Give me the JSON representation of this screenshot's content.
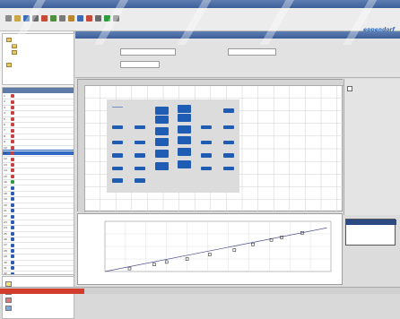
{
  "app": {
    "title": "",
    "logo_text": "eppendorf"
  },
  "colors": {
    "accent": "#3c5d97",
    "band": "#1f5cb4",
    "status": "#d23c2c"
  },
  "toolbar": {
    "icons": [
      "new-icon",
      "open-icon",
      "save-icon",
      "print-icon",
      "cut-icon",
      "copy-icon",
      "paste-icon",
      "undo-icon",
      "zoom-icon",
      "color-icon",
      "settings-icon",
      "help-icon",
      "export-icon"
    ]
  },
  "tree": {
    "items": [
      "",
      "",
      "",
      ""
    ]
  },
  "sample_table": {
    "headers": [
      "",
      "",
      "",
      ""
    ],
    "rows": [
      {
        "num": "1",
        "color": "#c84040",
        "name": "",
        "value": ""
      },
      {
        "num": "2",
        "color": "#c84040",
        "name": "",
        "value": ""
      },
      {
        "num": "3",
        "color": "#c84040",
        "name": "",
        "value": ""
      },
      {
        "num": "4",
        "color": "#c84040",
        "name": "",
        "value": ""
      },
      {
        "num": "5",
        "color": "#c84040",
        "name": "",
        "value": ""
      },
      {
        "num": "6",
        "color": "#c84040",
        "name": "",
        "value": ""
      },
      {
        "num": "7",
        "color": "#c84040",
        "name": "",
        "value": ""
      },
      {
        "num": "8",
        "color": "#c84040",
        "name": "",
        "value": ""
      },
      {
        "num": "9",
        "color": "#c84040",
        "name": "",
        "value": ""
      },
      {
        "num": "10",
        "color": "#c84040",
        "name": "",
        "value": ""
      },
      {
        "num": "11",
        "color": "#c84040",
        "name": "",
        "value": ""
      },
      {
        "num": "12",
        "color": "#c84040",
        "name": "",
        "value": ""
      },
      {
        "num": "13",
        "color": "#c84040",
        "name": "",
        "value": ""
      },
      {
        "num": "14",
        "color": "#c84040",
        "name": "",
        "value": ""
      },
      {
        "num": "15",
        "color": "#c84040",
        "name": "",
        "value": ""
      },
      {
        "num": "16",
        "color": "#2c9c3c",
        "name": "",
        "value": ""
      },
      {
        "num": "17",
        "color": "#2c5cb4",
        "name": "",
        "value": ""
      },
      {
        "num": "18",
        "color": "#2c5cb4",
        "name": "",
        "value": ""
      },
      {
        "num": "19",
        "color": "#2c5cb4",
        "name": "",
        "value": ""
      },
      {
        "num": "20",
        "color": "#2c5cb4",
        "name": "",
        "value": ""
      },
      {
        "num": "21",
        "color": "#2c5cb4",
        "name": "",
        "value": ""
      },
      {
        "num": "22",
        "color": "#2c5cb4",
        "name": "",
        "value": ""
      },
      {
        "num": "23",
        "color": "#2c5cb4",
        "name": "",
        "value": ""
      },
      {
        "num": "24",
        "color": "#2c5cb4",
        "name": "",
        "value": ""
      },
      {
        "num": "25",
        "color": "#2c5cb4",
        "name": "",
        "value": ""
      },
      {
        "num": "26",
        "color": "#2c5cb4",
        "name": "",
        "value": ""
      },
      {
        "num": "27",
        "color": "#2c5cb4",
        "name": "",
        "value": ""
      },
      {
        "num": "28",
        "color": "#2c5cb4",
        "name": "",
        "value": ""
      },
      {
        "num": "29",
        "color": "#2c5cb4",
        "name": "",
        "value": ""
      },
      {
        "num": "30",
        "color": "#2c5cb4",
        "name": "",
        "value": ""
      },
      {
        "num": "31",
        "color": "#2c5cb4",
        "name": "",
        "value": ""
      },
      {
        "num": "32",
        "color": "#2c5cb4",
        "name": "",
        "value": ""
      }
    ]
  },
  "legend": {
    "items": [
      {
        "color": "#f5e07a",
        "label": ""
      },
      {
        "color": "#8fd08f",
        "label": ""
      },
      {
        "color": "#e07a7a",
        "label": ""
      },
      {
        "color": "#7aa8e0",
        "label": ""
      }
    ]
  },
  "main_header": {
    "title": ""
  },
  "params": {
    "field1_label": "",
    "field1_value": "",
    "field2_label": "",
    "field2_value": "",
    "field3_label": "",
    "field3_value": ""
  },
  "right_panel": {
    "checkbox_label": ""
  },
  "info_box": {
    "title": "",
    "lines": [
      "",
      "",
      ""
    ]
  },
  "status": {
    "text": "",
    "progress": 0.21
  },
  "gel": {
    "lanes": [
      {
        "bands": [
          0.08,
          0.3,
          0.46,
          0.6,
          0.74,
          0.87
        ],
        "thick": [
          1,
          1,
          1,
          1,
          1,
          1
        ]
      },
      {
        "bands": [
          0.3,
          0.46,
          0.6,
          0.74,
          0.87
        ],
        "thick": [
          1,
          1,
          1,
          1,
          1
        ]
      },
      {
        "bands": [
          0.12,
          0.22,
          0.34,
          0.46,
          0.58,
          0.72
        ],
        "thick": [
          2,
          2,
          2,
          2,
          2,
          2
        ]
      },
      {
        "bands": [
          0.1,
          0.2,
          0.32,
          0.44,
          0.56,
          0.7
        ],
        "thick": [
          2,
          2,
          2,
          2,
          2,
          2
        ]
      },
      {
        "bands": [
          0.3,
          0.46,
          0.6,
          0.74
        ],
        "thick": [
          1,
          1,
          1,
          1
        ]
      },
      {
        "bands": [
          0.12,
          0.3,
          0.46,
          0.6,
          0.74
        ],
        "thick": [
          1,
          1,
          1,
          1,
          1
        ]
      }
    ]
  },
  "chart_data": {
    "type": "scatter",
    "title": "",
    "xlabel": "",
    "ylabel": "",
    "x_ticks": [
      "",
      "",
      "",
      "",
      "",
      "",
      "",
      "",
      "",
      "",
      "",
      ""
    ],
    "y_ticks": [
      "",
      "",
      "",
      "",
      ""
    ],
    "xlim": [
      0,
      11
    ],
    "ylim": [
      0,
      1
    ],
    "series": [
      {
        "x": [
          1.2,
          2.4,
          3.0,
          4.0,
          5.1,
          6.3,
          7.2,
          8.1,
          8.6,
          9.6
        ],
        "y": [
          0.06,
          0.14,
          0.19,
          0.25,
          0.34,
          0.43,
          0.54,
          0.63,
          0.68,
          0.77
        ]
      }
    ],
    "fit_line": [
      [
        0,
        -0.04
      ],
      [
        10.8,
        0.87
      ]
    ],
    "grid": true
  }
}
